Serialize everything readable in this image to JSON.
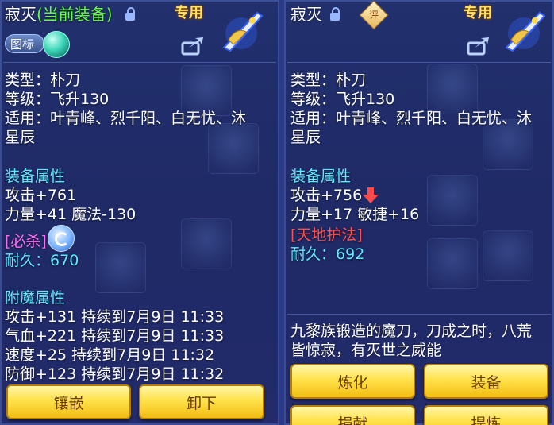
{
  "left": {
    "item_name": "寂灭",
    "equipped_tag": "(当前装备)",
    "exclusive_tag": "专用",
    "icon_toggle_label": "图标",
    "type_line": "类型：朴刀",
    "level_line": "等级：飞升130",
    "applicable_line1": "适用：叶青峰、烈千阳、白无忧、沐",
    "applicable_line2": "星辰",
    "attr_title": "装备属性",
    "attack": "攻击+761",
    "stats_line": "力量+41 魔法-130",
    "special": "[必杀]",
    "durability_label": "耐久：",
    "durability_value": "670",
    "enchant_title": "附魔属性",
    "enchants": [
      "攻击+131 持续到7月9日 11:33",
      "气血+221 持续到7月9日 11:33",
      "速度+25 持续到7月9日 11:32",
      "防御+123 持续到7月9日 11:32"
    ],
    "btn_inlay": "镶嵌",
    "btn_unequip": "卸下"
  },
  "right": {
    "item_name": "寂灭",
    "appraise_icon_text": "评",
    "exclusive_tag": "专用",
    "type_line": "类型：朴刀",
    "level_line": "等级：飞升130",
    "applicable_line1": "适用：叶青峰、烈千阳、白无忧、沐",
    "applicable_line2": "星辰",
    "attr_title": "装备属性",
    "attack": "攻击+756",
    "stats_line": "力量+17 敏捷+16",
    "special": "[天地护法]",
    "durability_label": "耐久：",
    "durability_value": "692",
    "description_line1": "九黎族锻造的魔刀，刀成之时，八荒",
    "description_line2": "皆惊寂，有灭世之威能",
    "btn_refine": "炼化",
    "btn_equip": "装备",
    "btn_donate": "捐献",
    "btn_extract": "提炼"
  },
  "colors": {
    "panel": "#223170",
    "accent_cyan": "#5fe9ff",
    "equipped_green": "#66ff3a",
    "special_magenta": "#ff6cf6",
    "special_red": "#ff5050",
    "tag_yellow": "#ffe36b",
    "button_gold": "#ffe24a"
  }
}
